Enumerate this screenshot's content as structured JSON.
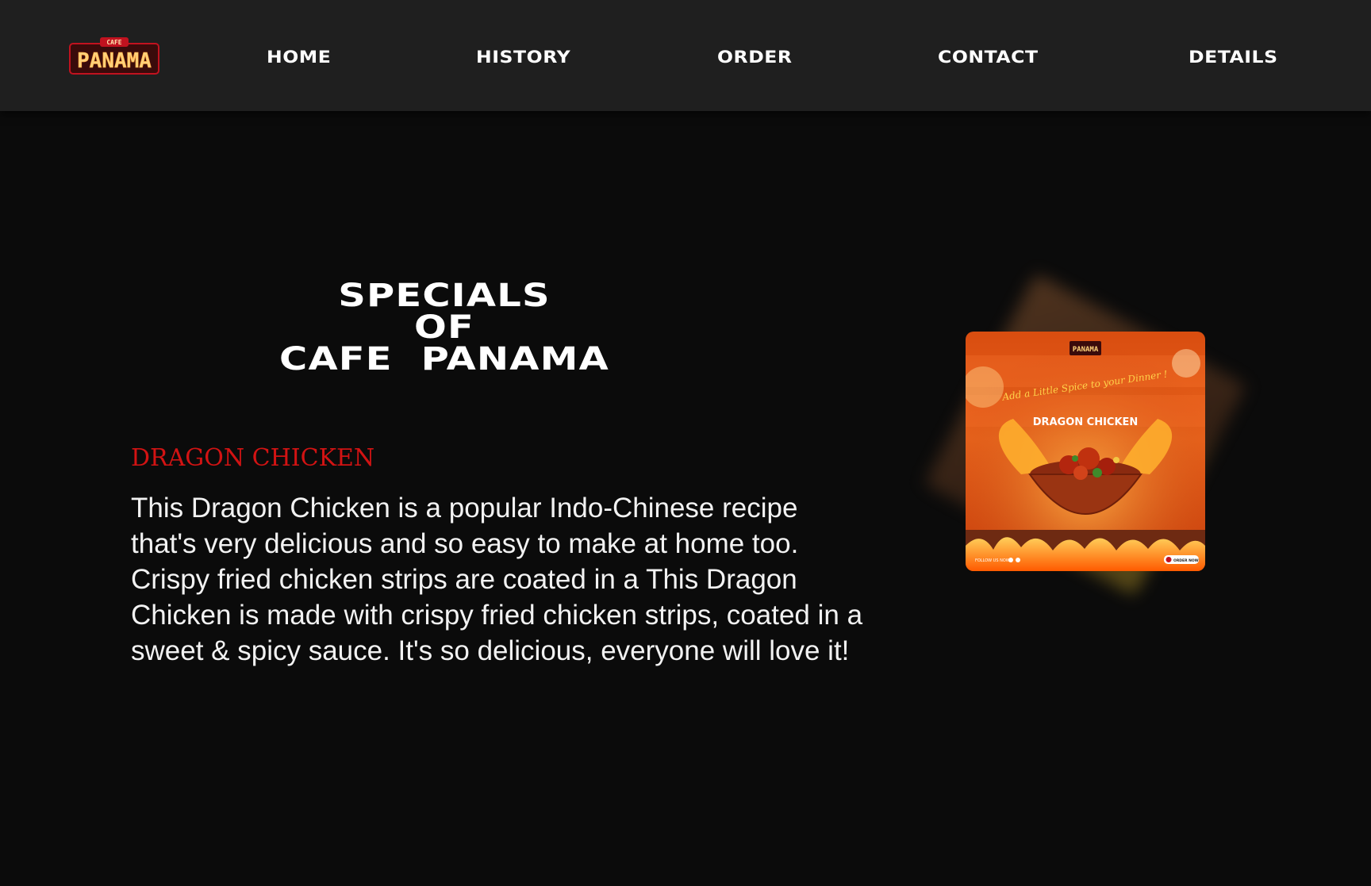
{
  "brand": {
    "logo_top": "CAFE",
    "logo_main": "PANAMA"
  },
  "nav": {
    "items": [
      "HOME",
      "HISTORY",
      "ORDER",
      "CONTACT",
      "DETAILS"
    ]
  },
  "hero": {
    "title_line1": "SPECIALS",
    "title_line2": "OF",
    "title_line3": "CAFE  PANAMA"
  },
  "special": {
    "name": "DRAGON CHICKEN",
    "description": "This Dragon Chicken is a popular Indo-Chinese recipe that's very delicious and so easy to make at home too. Crispy fried chicken strips are coated in a This Dragon Chicken is made with crispy fried chicken strips, coated in a sweet & spicy sauce. It's so delicious, everyone will love it!"
  },
  "poster": {
    "logo": "PANAMA",
    "script_text": "Add a Little Spice to your Dinner !",
    "dish": "DRAGON CHICKEN",
    "follow": "FOLLOW US NOW",
    "order_badge": "ORDER NOW"
  },
  "colors": {
    "accent_red": "#d21313",
    "nav_bg": "#1f1f1f",
    "page_bg": "#0b0b0b",
    "poster_orange": "#e7631c"
  }
}
